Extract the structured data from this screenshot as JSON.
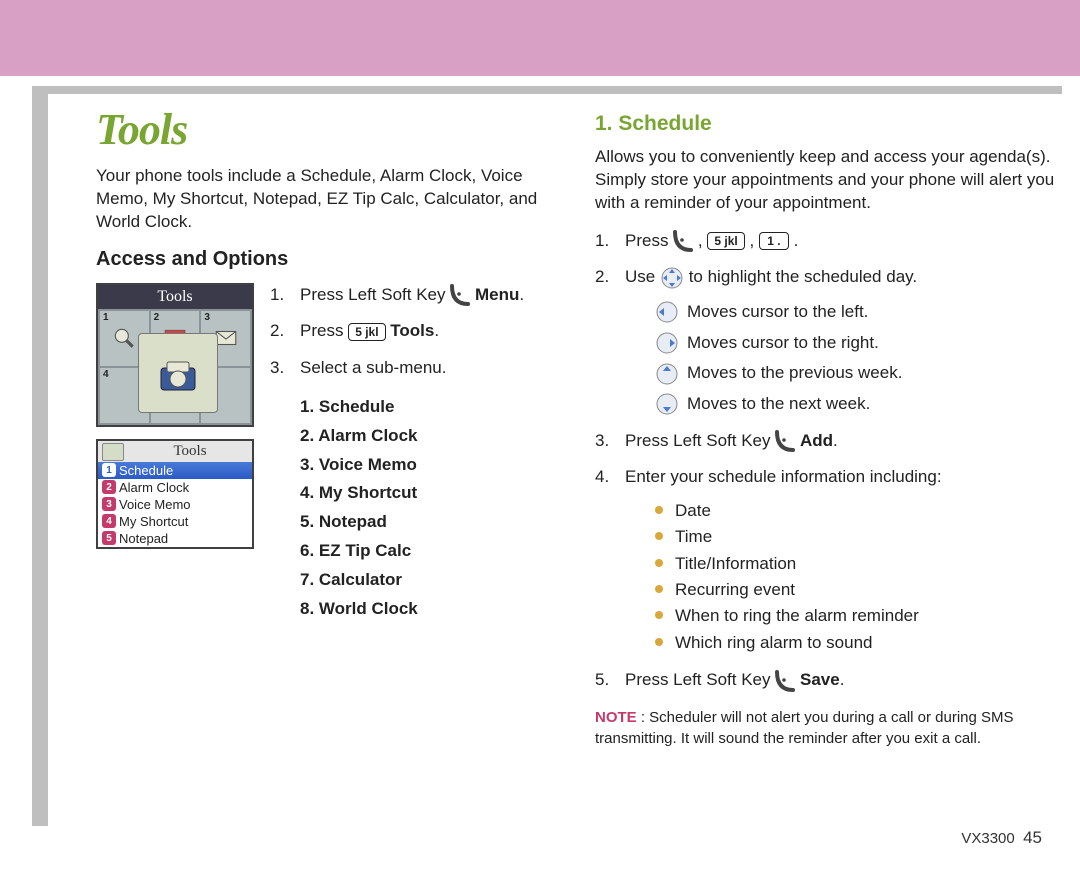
{
  "header": {
    "title": "Tools",
    "intro": "Your phone tools include a Schedule, Alarm Clock, Voice Memo, My Shortcut, Notepad, EZ Tip Calc, Calculator, and World Clock."
  },
  "access": {
    "heading": "Access and Options",
    "screen1_title": "Tools",
    "screen2_title": "Tools",
    "menu_items": [
      {
        "n": "1",
        "label": "Schedule",
        "sel": true
      },
      {
        "n": "2",
        "label": "Alarm Clock",
        "sel": false
      },
      {
        "n": "3",
        "label": "Voice Memo",
        "sel": false
      },
      {
        "n": "4",
        "label": "My Shortcut",
        "sel": false
      },
      {
        "n": "5",
        "label": "Notepad",
        "sel": false
      }
    ],
    "step1a": "Press Left Soft Key ",
    "step1b": " Menu",
    "step1c": ".",
    "step2a": "Press ",
    "key_5": "5 jkl",
    "step2b": " Tools",
    "step2c": ".",
    "step3": "Select a sub-menu.",
    "submenu": [
      "1. Schedule",
      "2. Alarm Clock",
      "3. Voice Memo",
      "4. My Shortcut",
      "5. Notepad",
      "6. EZ Tip Calc",
      "7. Calculator",
      "8. World Clock"
    ]
  },
  "schedule": {
    "heading": "1. Schedule",
    "intro": "Allows you to conveniently keep and access your agenda(s). Simply store your appointments and your phone will alert you with a reminder of your appointment.",
    "step1a": "Press ",
    "key_5": "5 jkl",
    "key_1": "1  .",
    "step2a": "Use ",
    "step2b": " to highlight the scheduled day.",
    "nav": [
      "Moves cursor to the left.",
      "Moves cursor to the right.",
      "Moves to the previous week.",
      "Moves to the next week."
    ],
    "step3a": "Press Left Soft Key ",
    "step3b": " Add",
    "step3c": ".",
    "step4": "Enter your schedule information including:",
    "bullets": [
      "Date",
      "Time",
      "Title/Information",
      "Recurring event",
      "When to ring the alarm reminder",
      "Which ring alarm to sound"
    ],
    "step5a": "Press Left Soft Key ",
    "step5b": " Save",
    "step5c": ".",
    "note_label": "NOTE",
    "note_text": " : Scheduler will not alert you during a call or during SMS transmitting. It will sound the reminder after you exit a call."
  },
  "footer": {
    "model": "VX3300",
    "page": "45"
  }
}
